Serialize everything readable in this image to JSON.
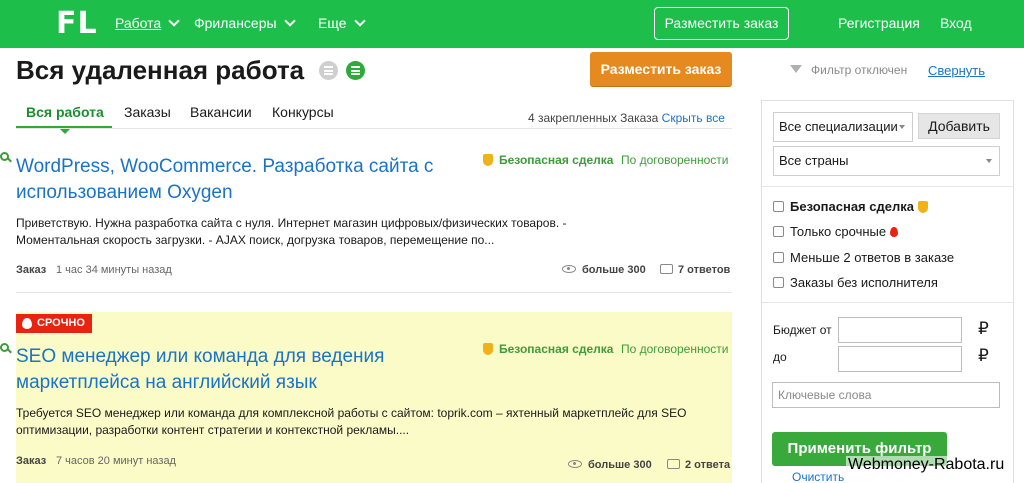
{
  "nav": {
    "logo": "FL",
    "work": "Работа",
    "freelancers": "Фрилансеры",
    "more": "Еще",
    "post_order": "Разместить заказ",
    "register": "Регистрация",
    "login": "Вход"
  },
  "header": {
    "title": "Вся удаленная работа",
    "post_order": "Разместить заказ",
    "filter_status": "Фильтр отключен",
    "collapse": "Свернуть"
  },
  "tabs": {
    "all": "Вся работа",
    "orders": "Заказы",
    "vacancies": "Вакансии",
    "contests": "Конкурсы",
    "pinned_count": "4 закрепленных Заказа",
    "hide_all": "Скрыть все"
  },
  "listings": [
    {
      "title": "WordPress, WooCommerce. Разработка сайта с использованием Oxygen",
      "safe_deal": "Безопасная сделка",
      "price": "По договоренности",
      "description": "Приветствую. Нужна разработка сайта с нуля.  Интернет магазин цифровых/физических товаров. - Моментальная скорость загрузки.  - AJAX поиск, догрузка товаров, перемещение по...",
      "type": "Заказ",
      "time": "1 час 34 минуты назад",
      "views": "больше 300",
      "answers": "7 ответов"
    },
    {
      "badge": "СРОЧНО",
      "title": "SEO менеджер или команда для ведения маркетплейса на английский язык",
      "safe_deal": "Безопасная сделка",
      "price": "По договоренности",
      "description": "Требуется SEO менеджер или команда для комплексной работы с сайтом: toprik.com – яхтенный маркетплейс для SEO оптимизации, разработки контент стратегии и контекстной рекламы....",
      "type": "Заказ",
      "time": "7 часов 20 минут назад",
      "views": "больше 300",
      "answers": "2 ответа"
    }
  ],
  "sidebar": {
    "specializations": "Все специализации",
    "add": "Добавить",
    "countries": "Все страны",
    "checkboxes": {
      "safe_deal": "Безопасная сделка",
      "urgent_only": "Только срочные",
      "less_two": "Меньше 2 ответов в заказе",
      "no_performer": "Заказы без исполнителя"
    },
    "budget_from": "Бюджет от",
    "budget_to": "до",
    "currency": "₽",
    "keywords_placeholder": "Ключевые слова",
    "apply": "Применить фильтр",
    "clear": "Очистить"
  },
  "watermark": "Webmoney-Rabota.ru",
  "colors": {
    "brand_green": "#1dbf4a",
    "accent_orange": "#e6891f",
    "link_blue": "#1a73c8",
    "urgent_red": "#e8230f",
    "urgent_bg": "#fbfbc8"
  }
}
